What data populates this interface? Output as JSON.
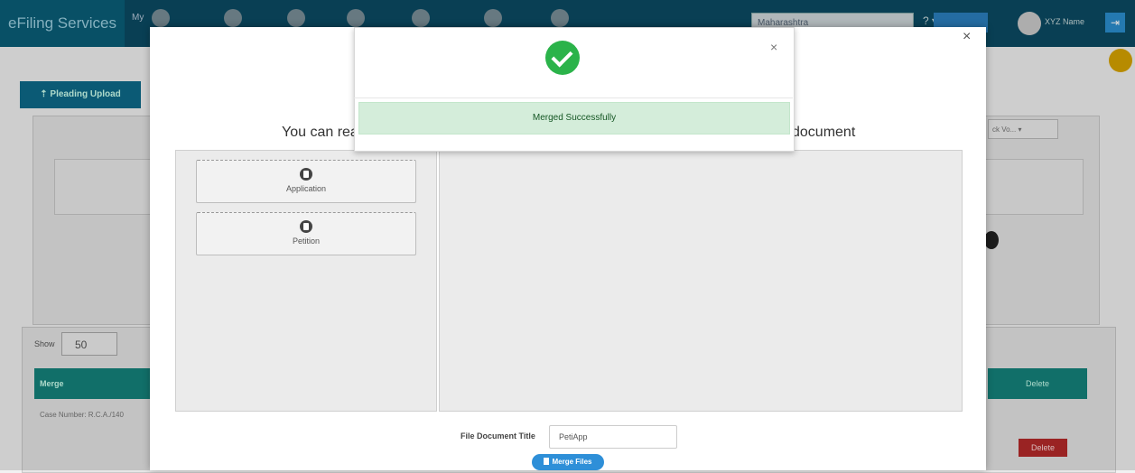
{
  "app": {
    "brand": "eFiling Services",
    "brand_my": "My",
    "state": "Maharashtra",
    "help": "? ▾",
    "top_button": "",
    "user": "XYZ Name",
    "pleading_upload": "⇡ Pleading Upload",
    "show_label": "Show",
    "show_value": "50",
    "merge_col": "Merge",
    "delete_col": "Delete",
    "case_number": "Case Number: R.C.A./140",
    "delete_btn": "Delete",
    "sort_value": "ck Vo... ▾"
  },
  "modal": {
    "heading_left": "You can rea",
    "heading_right": "document",
    "close": "×",
    "documents": [
      {
        "label": "Application",
        "icon": "file-icon"
      },
      {
        "label": "Petition",
        "icon": "file-icon"
      }
    ],
    "file_title_label": "File Document Title",
    "file_title_value": "PetiApp",
    "merge_button": "Merge Files"
  },
  "alert": {
    "close": "×",
    "icon": "check-circle-icon",
    "message": "Merged Successfully",
    "success_color": "#2bb34a"
  }
}
